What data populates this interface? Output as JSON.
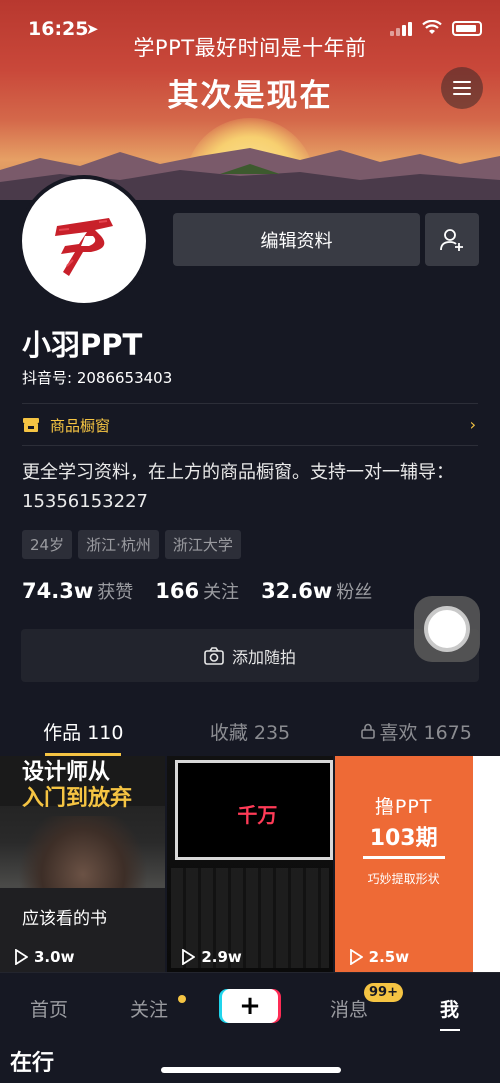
{
  "status": {
    "time": "16:25"
  },
  "banner": {
    "line1": "学PPT最好时间是十年前",
    "line2": "其次是现在"
  },
  "profile": {
    "edit_label": "编辑资料",
    "name": "小羽PPT",
    "douyin_id": "抖音号: 2086653403",
    "shop_label": "商品橱窗",
    "bio": "更全学习资料，在上方的商品橱窗。支持一对一辅导：15356153227",
    "tags": [
      "24岁",
      "浙江·杭州",
      "浙江大学"
    ],
    "stats": [
      {
        "num": "74.3w",
        "label": "获赞"
      },
      {
        "num": "166",
        "label": "关注"
      },
      {
        "num": "32.6w",
        "label": "粉丝"
      }
    ],
    "add_moment_label": "添加随拍"
  },
  "tabs": [
    {
      "label": "作品 110"
    },
    {
      "label": "收藏 235"
    },
    {
      "label": "喜欢 1675"
    }
  ],
  "videos": [
    {
      "title_line1": "设计师从",
      "title_line2": "入门到放弃",
      "caption": "应该看的书",
      "plays": "3.0w"
    },
    {
      "screen_text": "千万",
      "plays": "2.9w"
    },
    {
      "title_line1": "撸PPT",
      "title_line2": "103期",
      "subtitle": "巧妙提取形状",
      "plays": "2.5w"
    }
  ],
  "nav": {
    "home": "首页",
    "follow": "关注",
    "plus": "+",
    "messages": "消息",
    "messages_badge": "99+",
    "me": "我"
  },
  "corner_text": "在行",
  "colors": {
    "accent": "#f5c443",
    "background": "#161823",
    "button": "#393b44"
  }
}
